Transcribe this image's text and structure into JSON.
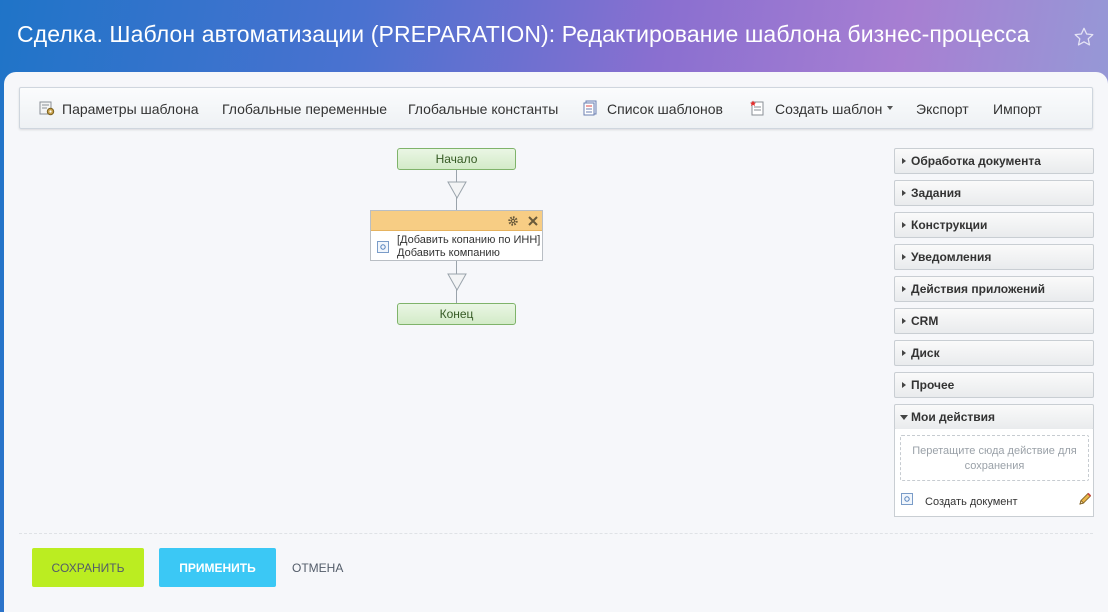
{
  "page": {
    "title": "Сделка. Шаблон автоматизации (PREPARATION): Редактирование шаблона бизнес-процесса"
  },
  "toolbar": {
    "items": [
      {
        "label": "Параметры шаблона",
        "icon": "template-settings-icon"
      },
      {
        "label": "Глобальные переменные"
      },
      {
        "label": "Глобальные константы"
      },
      {
        "label": "Список шаблонов",
        "icon": "template-list-icon"
      },
      {
        "label": "Создать шаблон",
        "icon": "create-template-icon",
        "dropdown": true
      },
      {
        "label": "Экспорт"
      },
      {
        "label": "Импорт"
      }
    ]
  },
  "designer": {
    "start_label": "Начало",
    "end_label": "Конец",
    "activity": {
      "text": "[Добавить копанию по ИНН] Добавить компанию"
    }
  },
  "panel": {
    "groups": [
      "Обработка документа",
      "Задания",
      "Конструкции",
      "Уведомления",
      "Действия приложений",
      "CRM",
      "Диск",
      "Прочее"
    ],
    "my_actions": {
      "title": "Мои действия",
      "dropzone": "Перетащите сюда действие для сохранения",
      "items": [
        "Создать документ"
      ]
    }
  },
  "actions": {
    "save": "Сохранить",
    "apply": "Применить",
    "cancel": "Отмена"
  },
  "colors": {
    "save_button": "#bbed21",
    "apply_button": "#3bc8f5",
    "activity_header": "#f7cd84",
    "terminal_node": "#d3ebc8"
  }
}
